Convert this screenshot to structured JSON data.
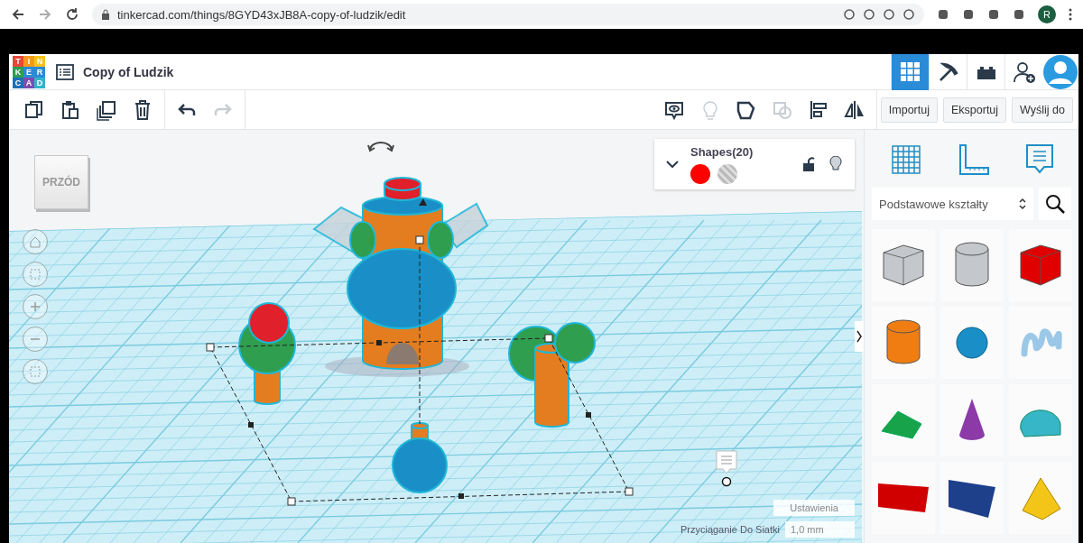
{
  "browser": {
    "url": "tinkercad.com/things/8GYD43xJB8A-copy-of-ludzik/edit",
    "profile_initial": "R"
  },
  "header": {
    "logo_letters": [
      "T",
      "I",
      "N",
      "K",
      "E",
      "R",
      "C",
      "A",
      "D"
    ],
    "title": "Copy of Ludzik",
    "views": [
      {
        "kind": "grid",
        "selected": true
      },
      {
        "kind": "pickaxe",
        "selected": false
      },
      {
        "kind": "bricks",
        "selected": false
      }
    ]
  },
  "toolbar": {
    "tools": [
      {
        "kind": "copy",
        "disabled": false
      },
      {
        "kind": "paste",
        "disabled": false
      },
      {
        "kind": "duplicate",
        "disabled": false
      },
      {
        "kind": "delete",
        "disabled": false
      },
      {
        "kind": "undo",
        "disabled": false
      },
      {
        "kind": "redo",
        "disabled": true
      }
    ],
    "view_tools": [
      {
        "kind": "note",
        "disabled": false
      },
      {
        "kind": "bulb",
        "disabled": true
      },
      {
        "kind": "group",
        "disabled": false
      },
      {
        "kind": "ungroup",
        "disabled": true
      },
      {
        "kind": "align",
        "disabled": false
      },
      {
        "kind": "mirror",
        "disabled": false
      }
    ],
    "buttons": [
      "Importuj",
      "Eksportuj",
      "Wyślij do"
    ]
  },
  "view_cube": {
    "label": "PRZÓD"
  },
  "inspector": {
    "title": "Shapes(20)",
    "swatches": [
      {
        "kind": "solid",
        "color": "#ff0000"
      },
      {
        "kind": "hole"
      }
    ],
    "locked": false
  },
  "panel": {
    "category": "Podstawowe kształty",
    "shapes": [
      {
        "kind": "box",
        "color": "#c4c8cc"
      },
      {
        "kind": "cylinder",
        "color": "#c4c8cc"
      },
      {
        "kind": "box",
        "color": "#e00000"
      },
      {
        "kind": "cylinder",
        "color": "#f07d12"
      },
      {
        "kind": "sphere",
        "color": "#1a8fc7"
      },
      {
        "kind": "scribble",
        "color": "#9cc8e8"
      },
      {
        "kind": "roof",
        "color": "#16a34a"
      },
      {
        "kind": "cone",
        "color": "#8b3aa8"
      },
      {
        "kind": "round-roof",
        "color": "#36b6c6"
      },
      {
        "kind": "text",
        "color": "#d00000"
      },
      {
        "kind": "tile",
        "color": "#1e3f8a"
      },
      {
        "kind": "pyramid",
        "color": "#f2c518"
      }
    ]
  },
  "settings": {
    "button": "Ustawienia",
    "snap_label": "Przyciąganie Do Siatki",
    "snap_value": "1,0 mm"
  }
}
